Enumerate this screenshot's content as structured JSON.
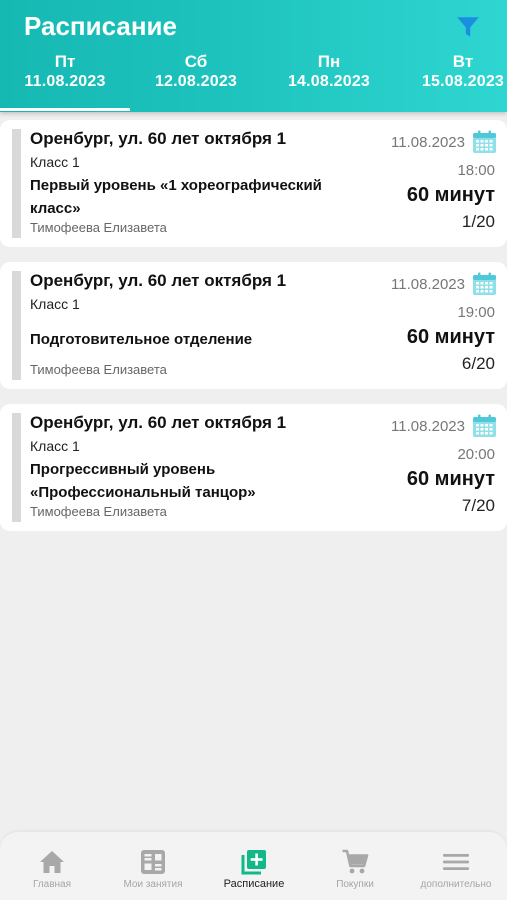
{
  "header": {
    "title": "Расписание",
    "filter_icon": "filter-icon",
    "accent_color": "#1ec3bd"
  },
  "tabs": [
    {
      "day": "Пт",
      "date": "11.08.2023",
      "selected": true
    },
    {
      "day": "Сб",
      "date": "12.08.2023",
      "selected": false
    },
    {
      "day": "Пн",
      "date": "14.08.2023",
      "selected": false
    },
    {
      "day": "Вт",
      "date": "15.08.2023",
      "selected": false
    }
  ],
  "lessons": [
    {
      "place": "Оренбург, ул. 60 лет октября 1",
      "class": "Класс 1",
      "title": "Первый уровень «1 хореографический класс»",
      "teacher": "Тимофеева Елизавета",
      "date": "11.08.2023",
      "time": "18:00",
      "duration": "60 минут",
      "seats": "1/20"
    },
    {
      "place": "Оренбург, ул. 60 лет октября 1",
      "class": "Класс 1",
      "title": "Подготовительное отделение",
      "teacher": "Тимофеева Елизавета",
      "date": "11.08.2023",
      "time": "19:00",
      "duration": "60 минут",
      "seats": "6/20"
    },
    {
      "place": "Оренбург, ул. 60 лет октября 1",
      "class": "Класс 1",
      "title": "Прогрессивный уровень «Профессиональный танцор»",
      "teacher": "Тимофеева Елизавета",
      "date": "11.08.2023",
      "time": "20:00",
      "duration": "60 минут",
      "seats": "7/20"
    }
  ],
  "bottom_nav": [
    {
      "label": "Главная",
      "icon": "home-icon",
      "active": false
    },
    {
      "label": "Мои занятия",
      "icon": "my-lessons-icon",
      "active": false
    },
    {
      "label": "Расписание",
      "icon": "schedule-add-icon",
      "active": true
    },
    {
      "label": "Покупки",
      "icon": "cart-icon",
      "active": false
    },
    {
      "label": "дополнительно",
      "icon": "menu-icon",
      "active": false
    }
  ]
}
